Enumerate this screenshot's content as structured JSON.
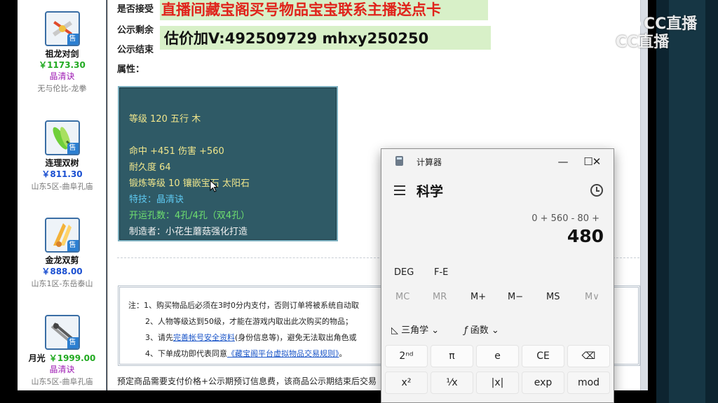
{
  "listing": [
    {
      "name": "祖龙对剑",
      "price": "￥1173.30",
      "skill": "晶清诀",
      "server": "无与伦比-龙拳",
      "sell_tag": "售",
      "icon": "twin-sword-icon",
      "price_color": "green"
    },
    {
      "name": "连理双树",
      "price": "￥811.30",
      "skill": "",
      "server": "山东5区-曲阜孔庙",
      "sell_tag": "售",
      "icon": "leaf-blade-icon",
      "price_color": "blue"
    },
    {
      "name": "金龙双剪",
      "price": "￥888.00",
      "skill": "",
      "server": "山东1区-东岳泰山",
      "sell_tag": "售",
      "icon": "golden-scissors-icon",
      "price_color": "blue"
    },
    {
      "name": "月光",
      "price": "￥1999.00",
      "skill": "晶清诀",
      "server": "山东5区-曲阜孔庙",
      "sell_tag": "售",
      "icon": "moonlight-blade-icon",
      "price_color": "green"
    }
  ],
  "info": {
    "line1": "是否接受",
    "line2": "公示剩余",
    "line3": "公示结束",
    "attr_label": "属性："
  },
  "attributes": {
    "level": "等级 120 五行 木",
    "hit": "命中 +451 伤害 +560",
    "durability": "耐久度 64",
    "forge": "锻炼等级 10 镶嵌宝石 太阳石",
    "special": "特技：晶清诀",
    "holes": "开运孔数：4孔/4孔（双4孔）",
    "maker": "制造者：小花生蘑菇强化打造"
  },
  "notes": {
    "n1": "注：1、购买物品后必须在3时0分内支付，否则订单将被系统自动取",
    "n2": "2、人物等级达到50级，才能在游戏内取出此次购买的物品；",
    "n3_pre": "3、请先",
    "n3_link": "完善帐号安全资料",
    "n3_post": "(身份信息等)，避免无法取出角色或",
    "n4_pre": "4、下单成功即代表同意",
    "n4_link": "《藏宝阁平台虚拟物品交易规则》",
    "n4_post": "。"
  },
  "footer_note": "预定商品需要支付价格+公示期预订信息费，该商品公示期结束后交易",
  "overlay": {
    "banner1": "直播间藏宝阁买号物品宝宝联系主播送点卡",
    "banner2": "估价加V:492509729    mhxy250250",
    "watermark": "CC直播"
  },
  "calculator": {
    "title": "计算器",
    "mode": "科学",
    "expression": "0 + 560 - 80 +",
    "result": "480",
    "deg": "DEG",
    "fe": "F-E",
    "memory": [
      "MC",
      "MR",
      "M+",
      "M−",
      "MS",
      "M∨"
    ],
    "trig": "三角学",
    "func": "函数",
    "keys_row1": [
      "2ⁿᵈ",
      "π",
      "e",
      "CE",
      "⌫"
    ],
    "keys_row2": [
      "x²",
      "¹⁄x",
      "|x|",
      "exp",
      "mod"
    ],
    "minimize": "—",
    "maximize": "☐",
    "close": "✕"
  }
}
